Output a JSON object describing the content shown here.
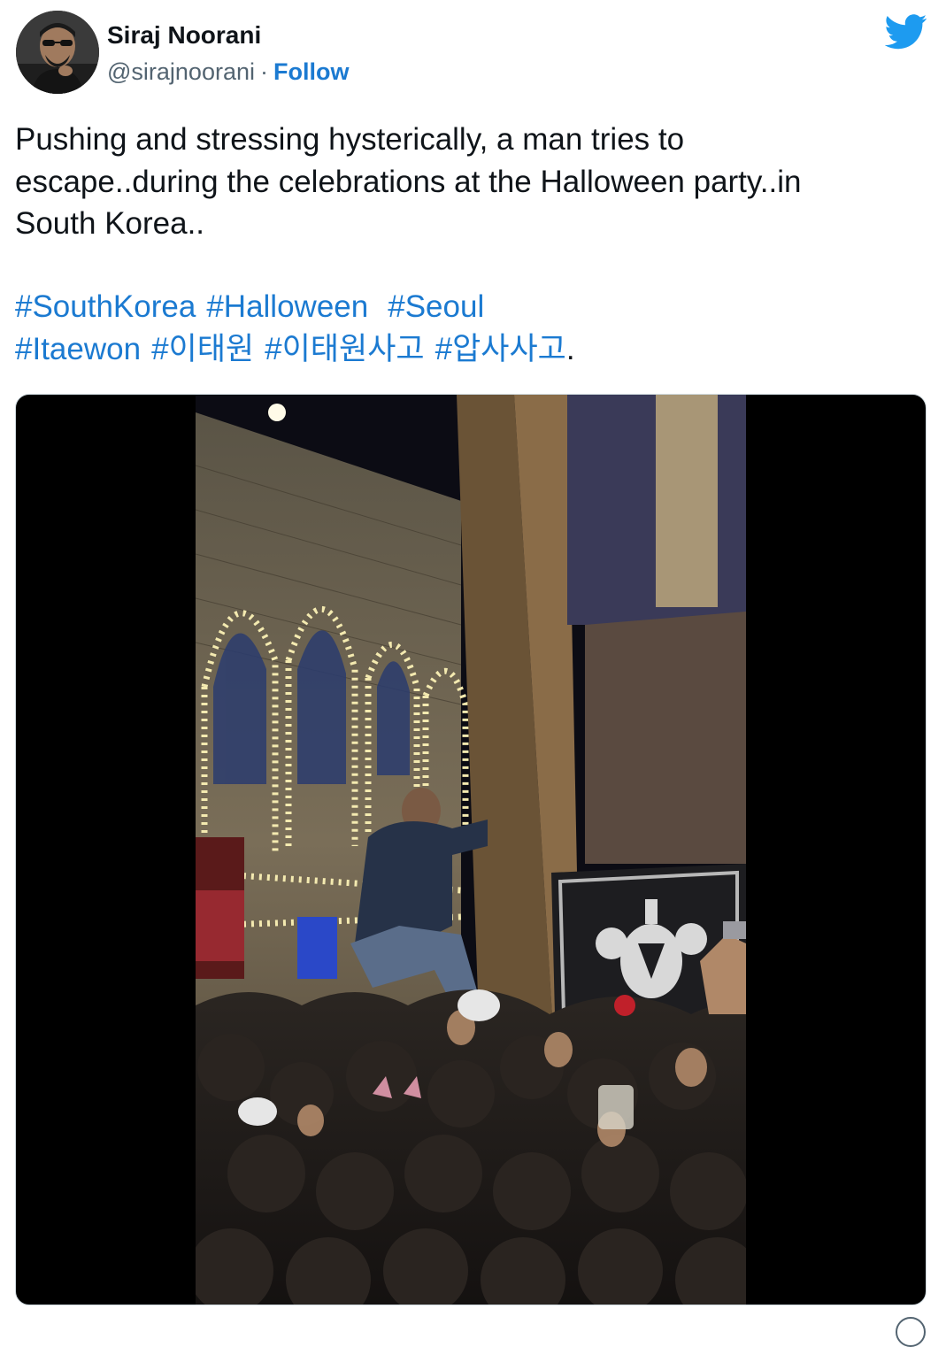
{
  "tweet": {
    "author": {
      "display_name": "Siraj Noorani",
      "handle": "@sirajnoorani",
      "separator": "·",
      "follow_label": "Follow",
      "avatar_icon": "avatar-photo"
    },
    "brand_icon": "twitter-bird-icon",
    "brand_color": "#1d9bf0",
    "link_color": "#1b7ad1",
    "text_lines": [
      "Pushing and stressing hysterically, a man tries to",
      "escape..during the celebrations at the Halloween party..in",
      "South Korea.."
    ],
    "hashtags": {
      "line1": [
        "#SouthKorea",
        "#Halloween",
        "#Seoul"
      ],
      "line2": [
        "#Itaewon",
        "#이태원",
        "#이태원사고",
        "#압사사고"
      ],
      "trailing": "."
    },
    "media": {
      "type": "video",
      "icon": "video-player"
    }
  }
}
